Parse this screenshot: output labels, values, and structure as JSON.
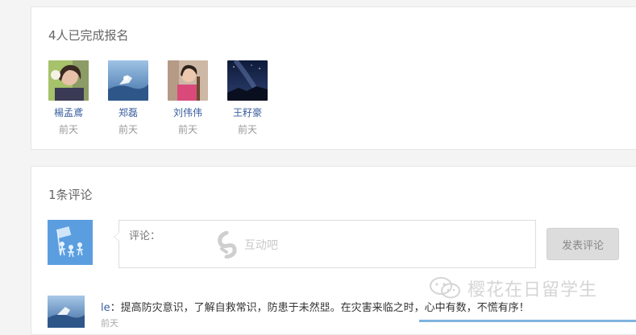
{
  "registration": {
    "title": "4人已完成报名",
    "people": [
      {
        "name": "楊孟鳶",
        "time": "前天"
      },
      {
        "name": "郑磊",
        "time": "前天"
      },
      {
        "name": "刘伟伟",
        "time": "前天"
      },
      {
        "name": "王籽豪",
        "time": "前天"
      }
    ]
  },
  "comments": {
    "title": "1条评论",
    "input_placeholder": "评论：",
    "input_watermark": "互动吧",
    "submit_label": "发表评论",
    "items": [
      {
        "user": "le",
        "separator": "：",
        "text": "提高防灾意识，了解自救常识，防患于未然𠁁。在灾害来临之时，心中有数，不慌有序！",
        "meta": "前天"
      }
    ]
  },
  "watermark": {
    "brand": "樱花在日留学生"
  },
  "icons": {
    "watermark": "handshake-icon",
    "brand": "wechat-icon"
  },
  "colors": {
    "link": "#3a5f9e",
    "muted": "#999999",
    "button_bg": "#dcdcdc"
  }
}
